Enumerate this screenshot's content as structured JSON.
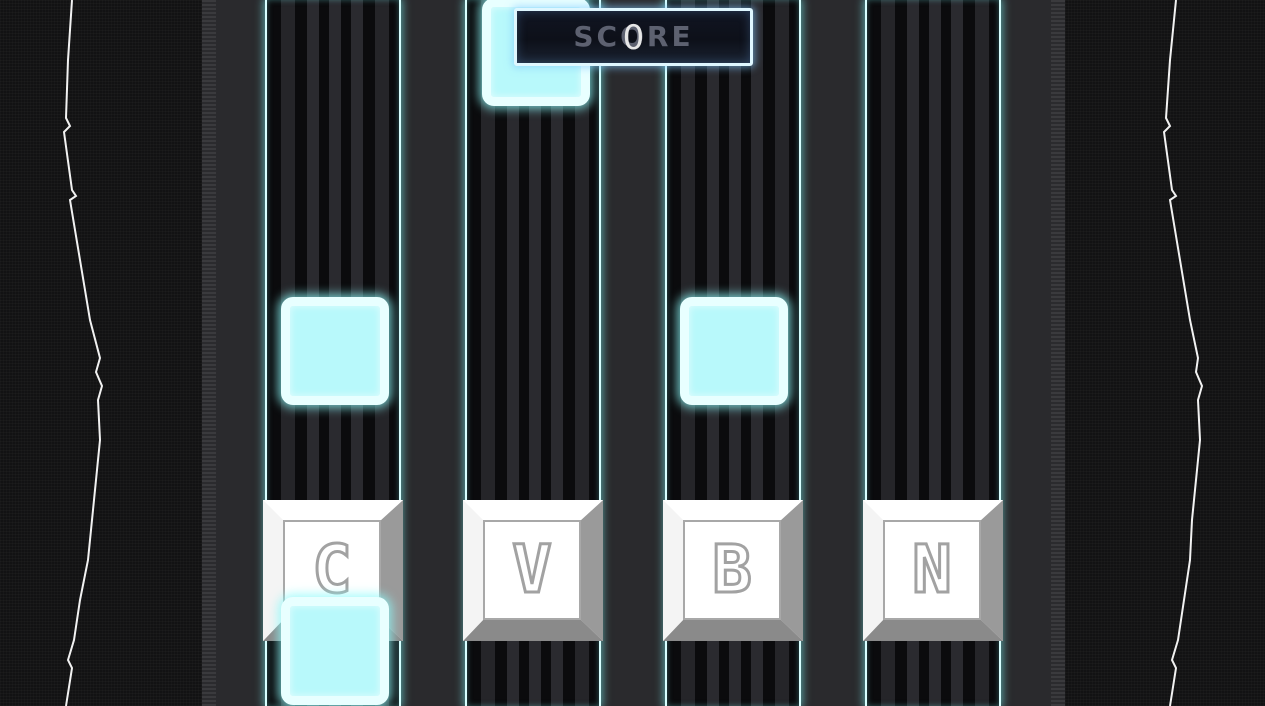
{
  "game": {
    "score_label": "SCORE",
    "score_value": "0",
    "lanes": [
      {
        "key": "C"
      },
      {
        "key": "V"
      },
      {
        "key": "B"
      },
      {
        "key": "N"
      }
    ]
  },
  "colors": {
    "note_fill": "#b8f9fb",
    "note_border": "#e8ffff",
    "lane_glow": "#78f0f0",
    "keycap_face": "#ffffff",
    "keycap_letter_outline": "#a2a2a2",
    "score_border": "#dff7ff"
  },
  "icons": [
    "note-block-icon",
    "keycap-icon"
  ]
}
